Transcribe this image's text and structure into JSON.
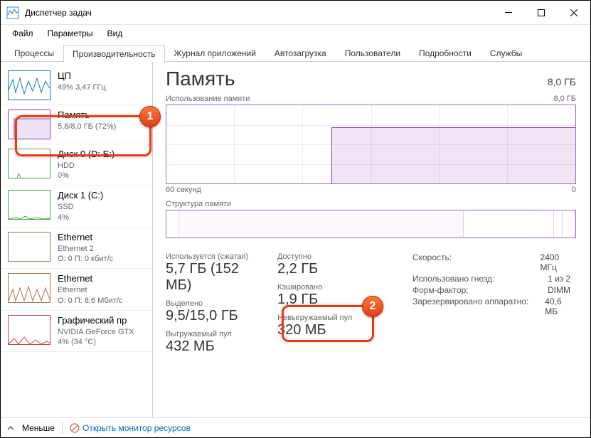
{
  "window": {
    "title": "Диспетчер задач"
  },
  "menu": {
    "file": "Файл",
    "options": "Параметры",
    "view": "Вид"
  },
  "tabs": {
    "processes": "Процессы",
    "performance": "Производительность",
    "apphistory": "Журнал приложений",
    "startup": "Автозагрузка",
    "users": "Пользователи",
    "details": "Подробности",
    "services": "Службы"
  },
  "sidebar": {
    "cpu": {
      "name": "ЦП",
      "sub": "49%  3,47 ГГц"
    },
    "memory": {
      "name": "Память",
      "sub": "5,8/8,0 ГБ (72%)"
    },
    "disk0": {
      "name": "Диск 0 (D: E:)",
      "sub1": "HDD",
      "sub2": "0%"
    },
    "disk1": {
      "name": "Диск 1 (C:)",
      "sub1": "SSD",
      "sub2": "4%"
    },
    "eth0": {
      "name": "Ethernet",
      "sub1": "Ethernet 2",
      "sub2": "О: 0  П: 0 кбит/с"
    },
    "eth1": {
      "name": "Ethernet",
      "sub1": "Ethernet",
      "sub2": "О: 0  П: 8,6 Мбит/с"
    },
    "gpu": {
      "name": "Графический пр",
      "sub1": "NVIDIA GeForce GTX",
      "sub2": "4% (34 °C)"
    }
  },
  "main": {
    "title": "Память",
    "total": "8,0 ГБ",
    "usage_label": "Использование памяти",
    "usage_max": "8,0 ГБ",
    "axis_left": "60 секунд",
    "axis_right": "0",
    "struct_label": "Структура памяти",
    "stats": {
      "inuse_label": "Используется (сжатая)",
      "inuse_val": "5,7 ГБ (152 МБ)",
      "avail_label": "Доступно",
      "avail_val": "2,2 ГБ",
      "committed_label": "Выделено",
      "committed_val": "9,5/15,0 ГБ",
      "cached_label": "Кэшировано",
      "cached_val": "1,9 ГБ",
      "paged_label": "Выгружаемый пул",
      "paged_val": "432 МБ",
      "nonpaged_label": "Невыгружаемый пул",
      "nonpaged_val": "320 МБ"
    },
    "info": {
      "speed_k": "Скорость:",
      "speed_v": "2400 МГц",
      "slots_k": "Использовано гнезд:",
      "slots_v": "1 из 2",
      "form_k": "Форм-фактор:",
      "form_v": "DIMM",
      "reserved_k": "Зарезервировано аппаратно:",
      "reserved_v": "40,6 МБ"
    }
  },
  "footer": {
    "less": "Меньше",
    "link": "Открыть монитор ресурсов"
  },
  "annotations": {
    "b1": "1",
    "b2": "2"
  },
  "chart_data": {
    "type": "area",
    "title": "Использование памяти",
    "xlabel": "секунд",
    "ylabel": "ГБ",
    "xlim": [
      0,
      60
    ],
    "ylim": [
      0,
      8.0
    ],
    "series": [
      {
        "name": "Память",
        "x": [
          60,
          40,
          35,
          30,
          20,
          10,
          0
        ],
        "values": [
          0,
          0,
          5.7,
          5.8,
          5.8,
          5.8,
          5.8
        ]
      }
    ]
  }
}
